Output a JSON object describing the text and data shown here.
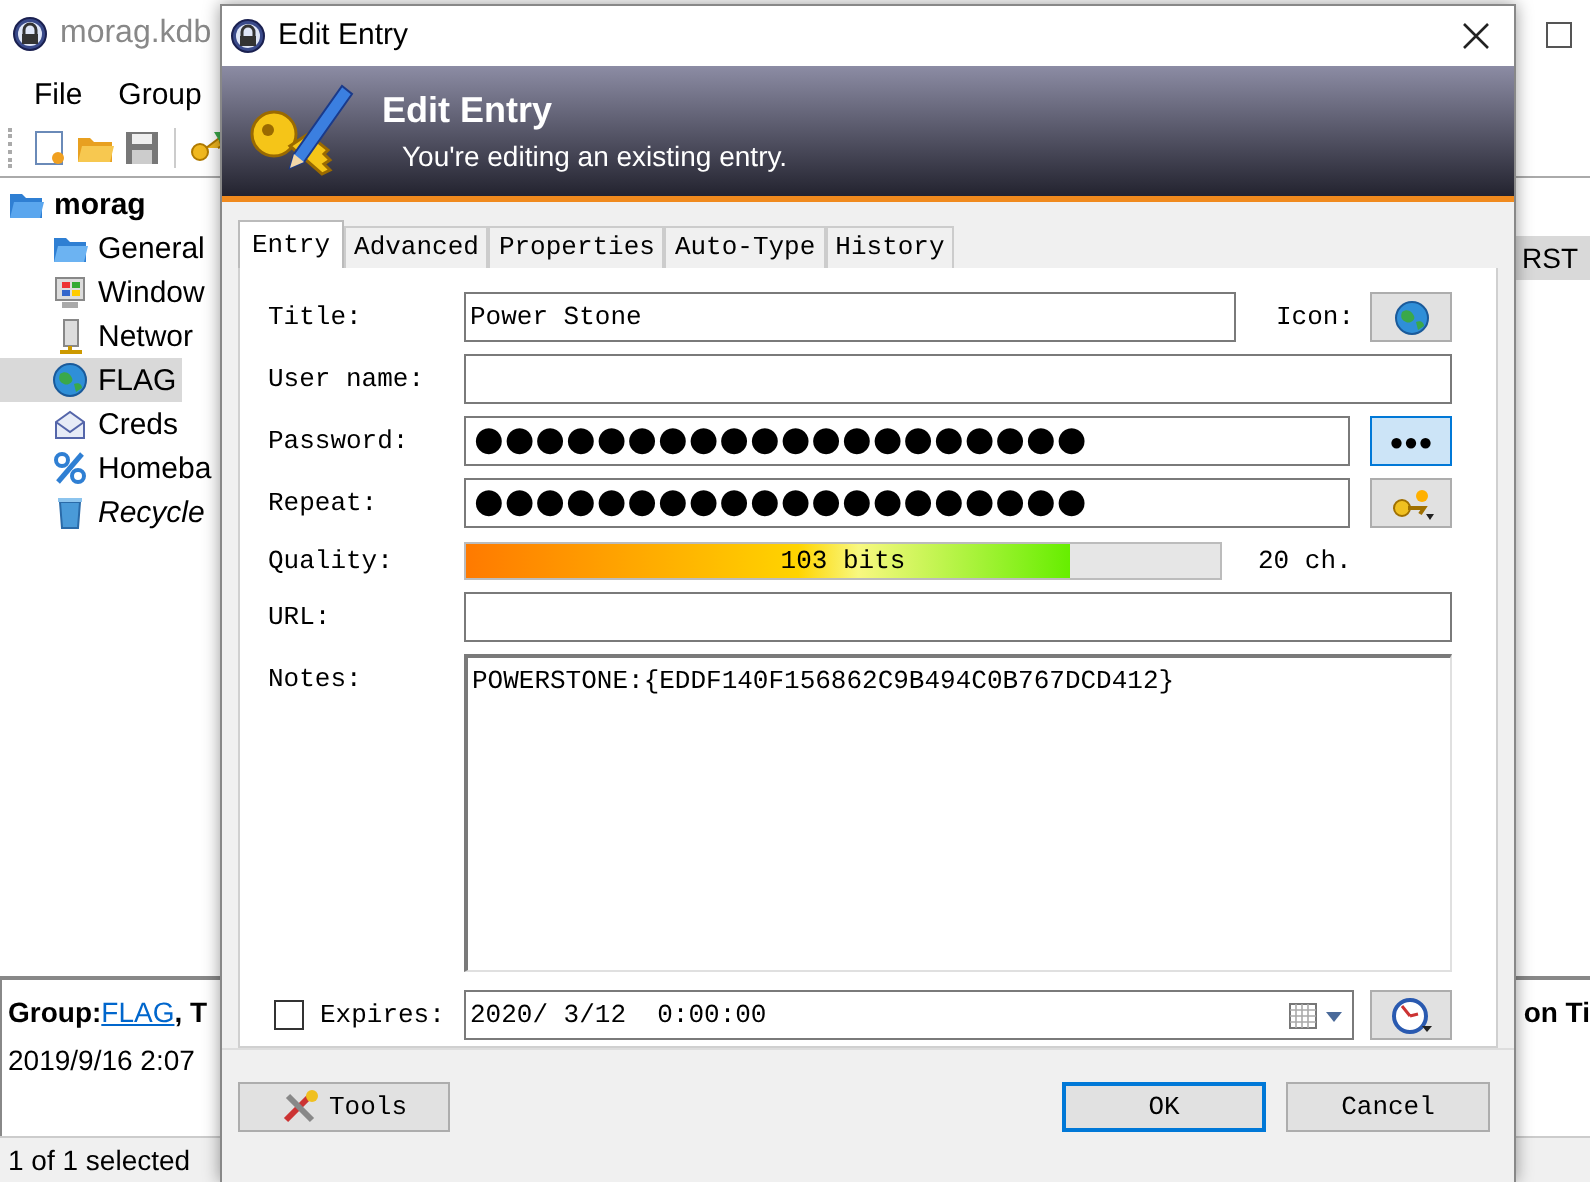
{
  "main_window": {
    "title": "morag.kdb",
    "menu": [
      "File",
      "Group"
    ],
    "tree": {
      "label": "morag",
      "kind": "folder-open",
      "children": [
        {
          "label": "General",
          "kind": "folder",
          "selected": false
        },
        {
          "label": "Window",
          "kind": "windows",
          "selected": false
        },
        {
          "label": "Networ",
          "kind": "network",
          "selected": false
        },
        {
          "label": "FLAG",
          "kind": "globe",
          "selected": true
        },
        {
          "label": "Creds",
          "kind": "mail",
          "selected": false
        },
        {
          "label": "Homeba",
          "kind": "percent",
          "selected": false
        },
        {
          "label": "Recycle",
          "kind": "recycle-bin",
          "selected": false
        }
      ]
    },
    "list_fragment": "RST",
    "details": {
      "group_label": "Group:",
      "group_link": "FLAG",
      "after_link": ", T",
      "date": "2019/9/16 2:07",
      "right_fragment": "on Ti"
    },
    "status_bar": "1 of 1 selected"
  },
  "dialog": {
    "title": "Edit Entry",
    "header": {
      "title": "Edit Entry",
      "subtitle": "You're editing an existing entry."
    },
    "tabs": [
      {
        "label": "Entry",
        "selected": true
      },
      {
        "label": "Advanced",
        "selected": false
      },
      {
        "label": "Properties",
        "selected": false
      },
      {
        "label": "Auto-Type",
        "selected": false
      },
      {
        "label": "History",
        "selected": false
      }
    ],
    "form": {
      "title": {
        "label": "Title:",
        "value": "Power Stone"
      },
      "icon_label": "Icon:",
      "user_name": {
        "label": "User name:"
      },
      "password": {
        "label": "Password:",
        "value": "●●●●●●●●●●●●●●●●●●●●",
        "reveal_button": "●●●",
        "reveal_pressed": true
      },
      "repeat": {
        "label": "Repeat:",
        "value": "●●●●●●●●●●●●●●●●●●●●"
      },
      "quality": {
        "label": "Quality:",
        "text": "103 bits",
        "level": 0.8,
        "chars": "20 ch."
      },
      "url": {
        "label": "URL:"
      },
      "notes": {
        "label": "Notes:",
        "value": "POWERSTONE:{EDDF140F156862C9B494C0B767DCD412}"
      },
      "expires": {
        "label": "Expires:",
        "checked": false,
        "value": "2020/ 3/12  0:00:00"
      }
    },
    "buttons": [
      {
        "label": "Tools",
        "kind": "tools",
        "default": false
      },
      {
        "label": "OK",
        "kind": "ok",
        "default": true
      },
      {
        "label": "Cancel",
        "kind": "cancel",
        "default": false
      }
    ]
  }
}
